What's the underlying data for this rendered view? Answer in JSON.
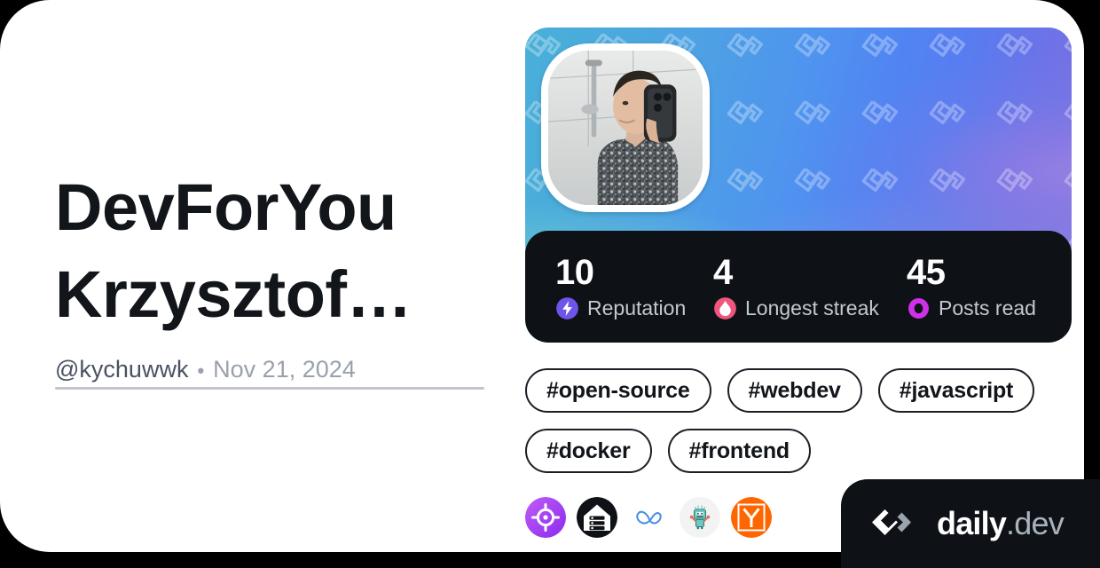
{
  "profile": {
    "name": "DevForYou Krzysztof…",
    "handle": "@kychuwwk",
    "separator": "•",
    "date": "Nov 21, 2024",
    "avatar_alt": "user-avatar-mirror-selfie"
  },
  "stats": [
    {
      "value": "10",
      "label": "Reputation",
      "icon": "reputation-bolt-icon",
      "color": "#6e54e8"
    },
    {
      "value": "4",
      "label": "Longest streak",
      "icon": "streak-flame-icon",
      "color": "#f0557e"
    },
    {
      "value": "45",
      "label": "Posts read",
      "icon": "posts-read-ring-icon",
      "color": "#cf31e8"
    }
  ],
  "tags": [
    {
      "label": "#open-source"
    },
    {
      "label": "#webdev"
    },
    {
      "label": "#javascript"
    },
    {
      "label": "#docker"
    },
    {
      "label": "#frontend"
    }
  ],
  "sources": [
    {
      "name": "source-target-badge",
      "color": "#a855f7"
    },
    {
      "name": "source-server-home-badge",
      "color": "#0e1217"
    },
    {
      "name": "source-infinity-badge",
      "color": "#ffffff"
    },
    {
      "name": "source-robot-badge",
      "color": "#f3f3f3"
    },
    {
      "name": "source-ycombinator-badge",
      "color": "#ff6600"
    }
  ],
  "brand": {
    "name_primary": "daily",
    "name_secondary": ".dev",
    "logo": "daily-dev-logo"
  },
  "colors": {
    "card_background": "#ffffff",
    "page_background": "#000000",
    "text_primary": "#12151a",
    "text_muted": "#9aa1ad",
    "handle": "#4a5263",
    "dark_panel": "#0e1217",
    "divider": "#c2c6cc"
  }
}
